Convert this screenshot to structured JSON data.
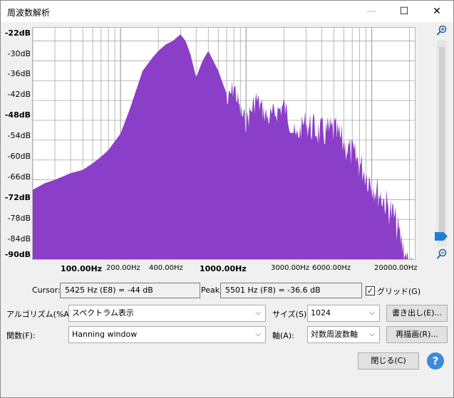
{
  "window": {
    "title": "周波数解析",
    "minimize": "—",
    "maximize": "☐",
    "close": "✕"
  },
  "plot": {
    "y_labels": [
      "-22dB",
      "-30dB",
      "-36dB",
      "-42dB",
      "-48dB",
      "-54dB",
      "-60dB",
      "-66dB",
      "-72dB",
      "-78dB",
      "-84dB",
      "-90dB"
    ],
    "x_labels": [
      "100.00Hz",
      "200.00Hz",
      "400.00Hz",
      "1000.00Hz",
      "3000.00Hz",
      "6000.00Hz",
      "20000.00Hz"
    ],
    "fill_color": "#8b3fc8",
    "grid_color": "#a8a8a8"
  },
  "chart_data": {
    "type": "area",
    "xscale": "log",
    "xlim": [
      20,
      22050
    ],
    "ylim": [
      -90,
      -20
    ],
    "x": [
      20,
      25,
      30,
      40,
      50,
      60,
      70,
      80,
      100,
      120,
      150,
      180,
      200,
      230,
      260,
      300,
      330,
      360,
      400,
      450,
      500,
      600,
      700,
      800,
      900,
      1000,
      1200,
      1500,
      2000,
      2500,
      3000,
      4000,
      5000,
      6000,
      8000,
      10000,
      12000,
      15000,
      18000,
      20000,
      22050
    ],
    "values": [
      -69,
      -67,
      -66,
      -64,
      -63,
      -61,
      -59,
      -57,
      -52,
      -44,
      -33,
      -29,
      -27,
      -25,
      -24,
      -22,
      -24,
      -28,
      -35,
      -30,
      -27,
      -33,
      -40,
      -34,
      -42,
      -45,
      -38,
      -44,
      -40,
      -50,
      -44,
      -47,
      -46,
      -50,
      -56,
      -62,
      -66,
      -72,
      -82,
      -88,
      -90
    ]
  },
  "cursor": {
    "label": "Cursor:",
    "value": "5425 Hz (E8) = -44 dB"
  },
  "peak": {
    "label": "Peak:",
    "value": "5501 Hz (F8) = -36.6 dB"
  },
  "grid": {
    "label": "グリッド(G)",
    "checked": "✓"
  },
  "algorithm": {
    "label": "アルゴリズム(%A):",
    "value": "スペクトラム表示"
  },
  "size": {
    "label": "サイズ(S):",
    "value": "1024"
  },
  "function": {
    "label": "関数(F):",
    "value": "Hanning window"
  },
  "axis": {
    "label": "軸(A):",
    "value": "対数周波数軸"
  },
  "buttons": {
    "export": "書き出し(E)...",
    "redraw": "再描画(R)...",
    "close": "閉じる(C)",
    "help": "?"
  },
  "icons": {
    "zoom_in": "🔍",
    "zoom_out": "🔍",
    "dropdown": "⌵"
  }
}
